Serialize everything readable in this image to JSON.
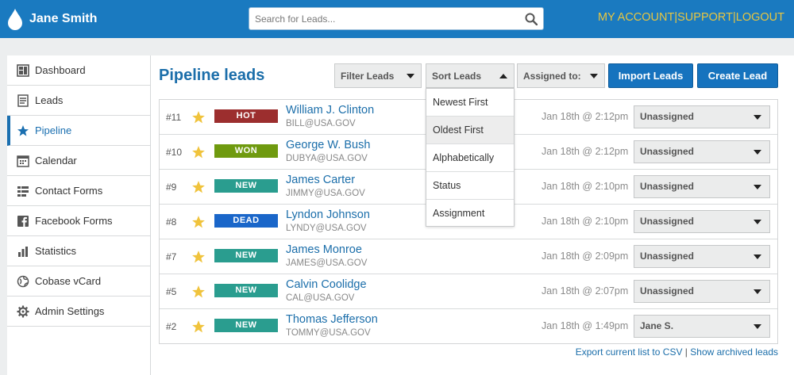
{
  "header": {
    "user_name": "Jane Smith",
    "search_placeholder": "Search for Leads...",
    "links": [
      "MY ACCOUNT",
      "SUPPORT",
      "LOGOUT"
    ],
    "separator": "|"
  },
  "sidebar": {
    "items": [
      {
        "label": "Dashboard",
        "icon": "dashboard-icon",
        "active": false
      },
      {
        "label": "Leads",
        "icon": "leads-icon",
        "active": false
      },
      {
        "label": "Pipeline",
        "icon": "star-icon",
        "active": true
      },
      {
        "label": "Calendar",
        "icon": "calendar-icon",
        "active": false
      },
      {
        "label": "Contact Forms",
        "icon": "form-icon",
        "active": false
      },
      {
        "label": "Facebook Forms",
        "icon": "facebook-icon",
        "active": false
      },
      {
        "label": "Statistics",
        "icon": "bar-chart-icon",
        "active": false
      },
      {
        "label": "Cobase vCard",
        "icon": "globe-icon",
        "active": false
      },
      {
        "label": "Admin Settings",
        "icon": "gear-icon",
        "active": false
      }
    ]
  },
  "main": {
    "title": "Pipeline leads",
    "filter_label": "Filter Leads",
    "sort_label": "Sort Leads",
    "assigned_label": "Assigned to:",
    "import_button": "Import Leads",
    "create_button": "Create Lead",
    "sort_options": [
      "Newest First",
      "Oldest First",
      "Alphabetically",
      "Status",
      "Assignment"
    ],
    "sort_selected": "Oldest First",
    "footer_export": "Export current list to CSV",
    "footer_archived": "Show archived leads",
    "footer_sep": "|"
  },
  "colors": {
    "HOT": "#9c2e2e",
    "WON": "#6f9a0f",
    "NEW": "#2a9d8f",
    "DEAD": "#1a66c9",
    "accent": "#1a7ac0",
    "star": "#f0c33c"
  },
  "leads": [
    {
      "id": "#11",
      "status": "HOT",
      "name": "William J. Clinton",
      "email": "BILL@USA.GOV",
      "date": "Jan 18th @ 2:12pm",
      "assigned": "Unassigned"
    },
    {
      "id": "#10",
      "status": "WON",
      "name": "George W. Bush",
      "email": "DUBYA@USA.GOV",
      "date": "Jan 18th @ 2:12pm",
      "assigned": "Unassigned"
    },
    {
      "id": "#9",
      "status": "NEW",
      "name": "James Carter",
      "email": "JIMMY@USA.GOV",
      "date": "Jan 18th @ 2:10pm",
      "assigned": "Unassigned"
    },
    {
      "id": "#8",
      "status": "DEAD",
      "name": "Lyndon Johnson",
      "email": "LYNDY@USA.GOV",
      "date": "Jan 18th @ 2:10pm",
      "assigned": "Unassigned"
    },
    {
      "id": "#7",
      "status": "NEW",
      "name": "James Monroe",
      "email": "JAMES@USA.GOV",
      "date": "Jan 18th @ 2:09pm",
      "assigned": "Unassigned"
    },
    {
      "id": "#5",
      "status": "NEW",
      "name": "Calvin Coolidge",
      "email": "CAL@USA.GOV",
      "date": "Jan 18th @ 2:07pm",
      "assigned": "Unassigned"
    },
    {
      "id": "#2",
      "status": "NEW",
      "name": "Thomas Jefferson",
      "email": "TOMMY@USA.GOV",
      "date": "Jan 18th @ 1:49pm",
      "assigned": "Jane S."
    }
  ]
}
